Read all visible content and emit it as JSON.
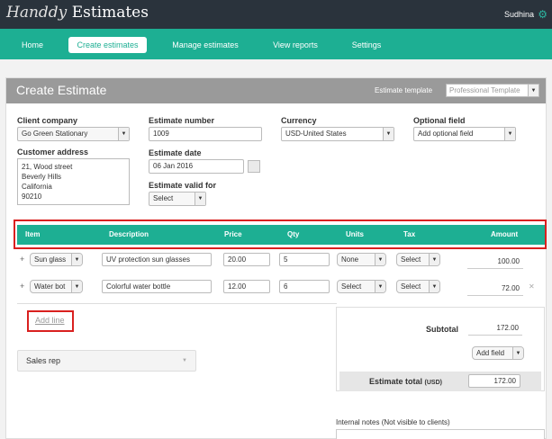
{
  "brand": {
    "script": "Handdy",
    "name": "Estimates"
  },
  "user": {
    "name": "Sudhina"
  },
  "nav": [
    "Home",
    "Create estimates",
    "Manage estimates",
    "View reports",
    "Settings"
  ],
  "page": {
    "title": "Create Estimate",
    "template_label": "Estimate template",
    "template_value": "Professional Template"
  },
  "form": {
    "client_company_label": "Client company",
    "client_company": "Go Green Stationary",
    "estimate_number_label": "Estimate number",
    "estimate_number": "1009",
    "currency_label": "Currency",
    "currency": "USD-United States",
    "optional_field_label": "Optional field",
    "optional_field": "Add optional field",
    "customer_address_label": "Customer address",
    "address_lines": [
      "21, Wood street",
      "Beverly Hills",
      "California",
      "90210"
    ],
    "estimate_date_label": "Estimate date",
    "estimate_date": "06 Jan 2016",
    "valid_for_label": "Estimate valid for",
    "valid_for": "Select"
  },
  "table": {
    "headers": [
      "Item",
      "Description",
      "Price",
      "Qty",
      "Units",
      "Tax",
      "Amount"
    ],
    "rows": [
      {
        "item": "Sun glass",
        "description": "UV protection sun glasses",
        "price": "20.00",
        "qty": "5",
        "units": "None",
        "tax": "Select",
        "amount": "100.00"
      },
      {
        "item": "Water bot",
        "description": "Colorful water bottle",
        "price": "12.00",
        "qty": "6",
        "units": "Select",
        "tax": "Select",
        "amount": "72.00"
      }
    ],
    "add_line": "Add line"
  },
  "summary": {
    "subtotal_label": "Subtotal",
    "subtotal": "172.00",
    "add_field": "Add field",
    "total_label": "Estimate total",
    "total_currency": "(USD)",
    "total": "172.00"
  },
  "sales_rep": "Sales rep",
  "notes_label": "Internal notes (Not visible to clients)",
  "colors": {
    "teal": "#1daf93",
    "dark": "#2a333c",
    "highlight": "#d9201f"
  }
}
